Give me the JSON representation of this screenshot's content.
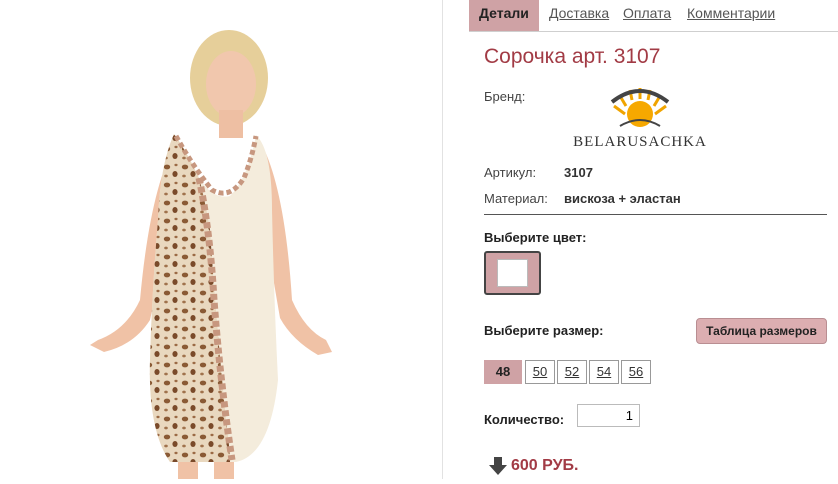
{
  "tabs": [
    {
      "label": "Детали",
      "active": true
    },
    {
      "label": "Доставка"
    },
    {
      "label": "Оплата"
    },
    {
      "label": "Комментарии"
    }
  ],
  "product": {
    "title": "Сорочка арт. 3107",
    "brand_label": "Бренд:",
    "brand_logo_text": "BELARUSACHKA",
    "article_label": "Артикул:",
    "article_value": "3107",
    "material_label": "Материал:",
    "material_value": "вискоза + эластан"
  },
  "color": {
    "heading": "Выберите цвет:",
    "selected_swatch_color": "#ffffff"
  },
  "size": {
    "heading": "Выберите размер:",
    "table_button": "Таблица размеров",
    "options": [
      "48",
      "50",
      "52",
      "54",
      "56"
    ],
    "selected": "48"
  },
  "quantity": {
    "label": "Количество:",
    "value": "1"
  },
  "price": {
    "text": "600 РУБ."
  },
  "colors": {
    "accent": "#a23b45",
    "tab_active_bg": "#cfa2a5"
  }
}
